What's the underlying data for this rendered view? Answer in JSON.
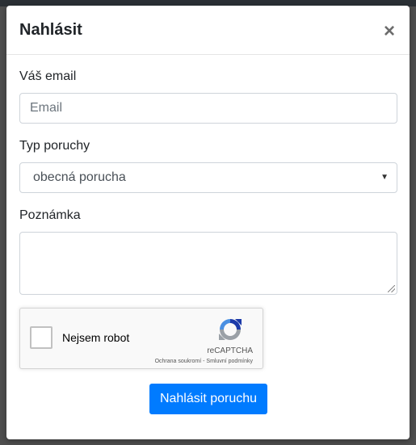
{
  "modal": {
    "title": "Nahlásit",
    "close_label": "×"
  },
  "form": {
    "email_label": "Váš email",
    "email_placeholder": "Email",
    "email_value": "",
    "type_label": "Typ poruchy",
    "type_selected": "obecná porucha",
    "note_label": "Poznámka",
    "note_value": ""
  },
  "recaptcha": {
    "checkbox_label": "Nejsem robot",
    "brand": "reCAPTCHA",
    "privacy_link": "Ochrana soukromí",
    "separator": " - ",
    "terms_link": "Smluvní podmínky",
    "logo_icon": "recaptcha-icon"
  },
  "submit": {
    "label": "Nahlásit poruchu",
    "color": "#007bff"
  }
}
